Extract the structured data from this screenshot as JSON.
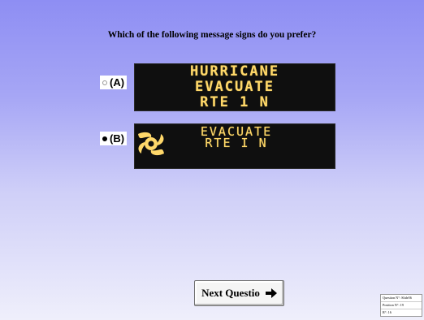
{
  "question": "Which of the following message signs do you prefer?",
  "options": [
    {
      "label": "(A)",
      "selected": false,
      "sign_lines": [
        "HURRICANE",
        "EVACUATE",
        "RTE 1 N"
      ]
    },
    {
      "label": "(B)",
      "selected": true,
      "sign_lines": [
        "EVACUATE",
        "RTE I N"
      ],
      "sign_icon": "hurricane-symbol-icon"
    }
  ],
  "next_button": {
    "label": "Next Questio",
    "icon": "right-arrow-icon"
  },
  "status": {
    "question_no": "Question N°: Slide56",
    "position_no": "Position N°: 19",
    "r_no": "R°: 16"
  },
  "colors": {
    "sign_text": "#ffd86a",
    "sign_background": "#0f0f0f",
    "background_top": "#8e8ef3",
    "background_bottom": "#efeffb"
  }
}
